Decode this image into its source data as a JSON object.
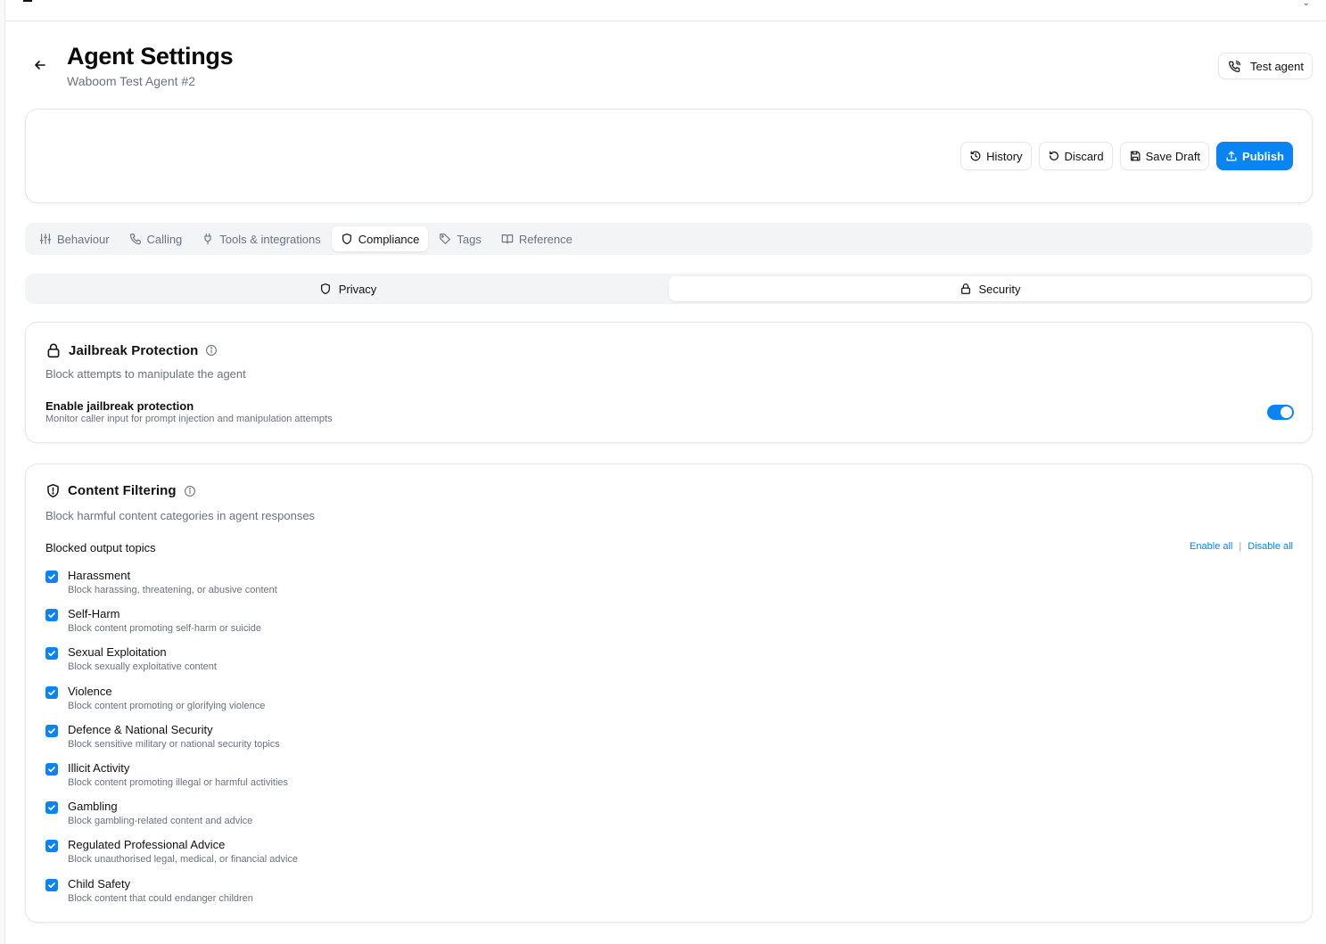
{
  "header": {
    "title": "Agent Settings",
    "subtitle": "Waboom Test Agent #2",
    "test_agent_label": "Test agent"
  },
  "actions": {
    "history": "History",
    "discard": "Discard",
    "save_draft": "Save Draft",
    "publish": "Publish"
  },
  "tabs": [
    {
      "label": "Behaviour",
      "icon": "sliders-icon"
    },
    {
      "label": "Calling",
      "icon": "phone-icon"
    },
    {
      "label": "Tools & integrations",
      "icon": "plug-icon"
    },
    {
      "label": "Compliance",
      "icon": "shield-icon",
      "active": true
    },
    {
      "label": "Tags",
      "icon": "tag-icon"
    },
    {
      "label": "Reference",
      "icon": "book-icon"
    }
  ],
  "subtabs": [
    {
      "label": "Privacy",
      "icon": "shield-icon"
    },
    {
      "label": "Security",
      "icon": "lock-icon",
      "active": true
    }
  ],
  "jailbreak": {
    "title": "Jailbreak Protection",
    "description": "Block attempts to manipulate the agent",
    "toggle_label": "Enable jailbreak protection",
    "toggle_sub": "Monitor caller input for prompt injection and manipulation attempts",
    "enabled": true
  },
  "content_filtering": {
    "title": "Content Filtering",
    "description": "Block harmful content categories in agent responses",
    "section_label": "Blocked output topics",
    "enable_all": "Enable all",
    "separator": "|",
    "disable_all": "Disable all",
    "topics": [
      {
        "label": "Harassment",
        "desc": "Block harassing, threatening, or abusive content",
        "checked": true
      },
      {
        "label": "Self-Harm",
        "desc": "Block content promoting self-harm or suicide",
        "checked": true
      },
      {
        "label": "Sexual Exploitation",
        "desc": "Block sexually exploitative content",
        "checked": true
      },
      {
        "label": "Violence",
        "desc": "Block content promoting or glorifying violence",
        "checked": true
      },
      {
        "label": "Defence & National Security",
        "desc": "Block sensitive military or national security topics",
        "checked": true
      },
      {
        "label": "Illicit Activity",
        "desc": "Block content promoting illegal or harmful activities",
        "checked": true
      },
      {
        "label": "Gambling",
        "desc": "Block gambling-related content and advice",
        "checked": true
      },
      {
        "label": "Regulated Professional Advice",
        "desc": "Block unauthorised legal, medical, or financial advice",
        "checked": true
      },
      {
        "label": "Child Safety",
        "desc": "Block content that could endanger children",
        "checked": true
      }
    ]
  },
  "colors": {
    "accent": "#0b84f3",
    "muted_text": "#6b7280",
    "border": "#e5e7eb"
  }
}
